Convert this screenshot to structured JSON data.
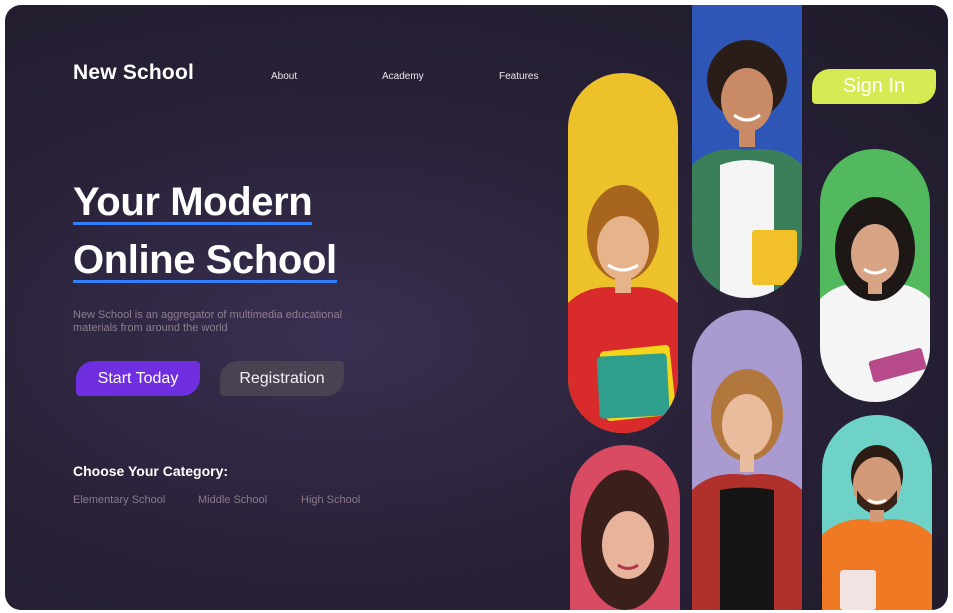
{
  "header": {
    "logo": "New School",
    "nav": [
      {
        "label": "About"
      },
      {
        "label": "Academy"
      },
      {
        "label": "Features"
      }
    ],
    "sign_in_label": "Sign In"
  },
  "hero": {
    "title_line1": "Your Modern",
    "title_line2": "Online School",
    "description": "New School is an aggregator of multimedia educational materials from around the world",
    "start_label": "Start Today",
    "registration_label": "Registration"
  },
  "categories": {
    "title": "Choose Your Category:",
    "items": [
      {
        "label": "Elementary School"
      },
      {
        "label": "Middle School"
      },
      {
        "label": "High School"
      }
    ]
  },
  "colors": {
    "primary": "#6f2fe0",
    "accent_sign_in": "#d7ea54",
    "underline": "#2f7fff",
    "card_yellow": "#ecc12a",
    "card_blue": "#2e56b6",
    "card_green": "#52b95f",
    "card_purple": "#a99bd0",
    "card_pink": "#d94a63",
    "card_teal": "#6fd2c8"
  }
}
